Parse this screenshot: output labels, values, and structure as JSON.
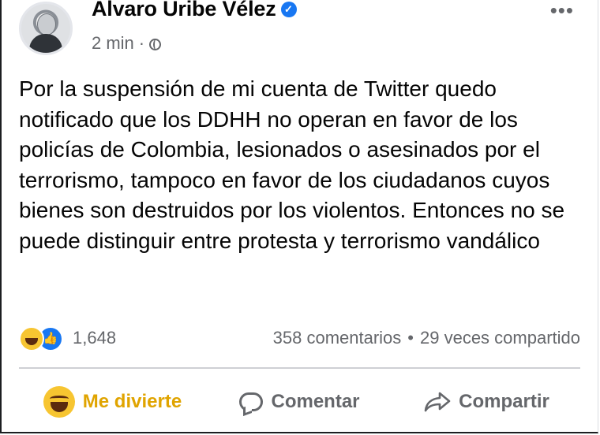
{
  "post": {
    "author": "Alvaro Uribe Vélez",
    "time": "2 min",
    "separator": "·",
    "text": "Por la suspensión de mi cuenta de Twitter quedo notificado que los DDHH no operan en favor de los policías de Colombia, lesionados o asesinados por el terrorismo, tampoco en favor de los ciudadanos cuyos bienes son destruidos por los violentos. Entonces no se puede distinguir entre protesta y terrorismo vandálico",
    "more": "•••"
  },
  "stats": {
    "reactions": "1,648",
    "comments": "358 comentarios",
    "dot": "•",
    "shares": "29 veces compartido"
  },
  "actions": {
    "react_label": "Me divierte",
    "comment_label": "Comentar",
    "share_label": "Compartir"
  },
  "icons": {
    "verified": "verified-badge-icon",
    "audience": "globe-icon",
    "reactions": [
      "haha-icon",
      "like-icon"
    ]
  },
  "colors": {
    "accent_react": "#e0a400",
    "verified": "#1877f2",
    "secondary_text": "#65676b"
  }
}
